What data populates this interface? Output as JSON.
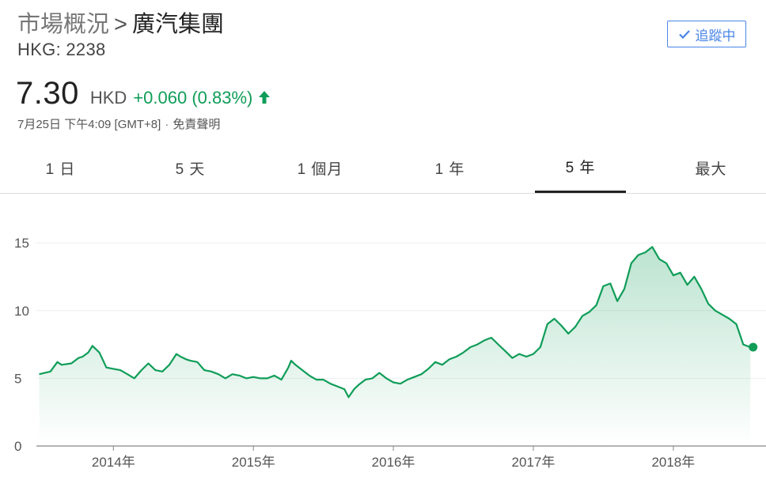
{
  "breadcrumb": {
    "parent": "市場概況",
    "separator": ">",
    "current": "廣汽集團"
  },
  "ticker": "HKG: 2238",
  "follow_button": {
    "label": "追蹤中",
    "icon": "check-icon",
    "color": "#4a86e8"
  },
  "quote": {
    "price": "7.30",
    "currency": "HKD",
    "change": "+0.060 (0.83%)",
    "direction_icon": "arrow-up-icon",
    "change_color": "#0f9d58"
  },
  "meta": {
    "timestamp": "7月25日 下午4:09 [GMT+8]",
    "separator": "·",
    "disclaimer": "免責聲明"
  },
  "tabs": [
    {
      "label": "1 日",
      "active": false
    },
    {
      "label": "5 天",
      "active": false
    },
    {
      "label": "1 個月",
      "active": false
    },
    {
      "label": "1 年",
      "active": false
    },
    {
      "label": "5 年",
      "active": true
    },
    {
      "label": "最大",
      "active": false
    }
  ],
  "chart_data": {
    "type": "area",
    "title": "",
    "xlabel": "",
    "ylabel": "",
    "line_color": "#0f9d58",
    "grid": true,
    "ylim": [
      0,
      16
    ],
    "xlim": [
      2013.45,
      2018.6
    ],
    "yticks": [
      {
        "value": 0,
        "label": "0"
      },
      {
        "value": 5,
        "label": "5"
      },
      {
        "value": 10,
        "label": "10"
      },
      {
        "value": 15,
        "label": "15"
      }
    ],
    "xticks": [
      {
        "value": 2014,
        "label": "2014年"
      },
      {
        "value": 2015,
        "label": "2015年"
      },
      {
        "value": 2016,
        "label": "2016年"
      },
      {
        "value": 2017,
        "label": "2017年"
      },
      {
        "value": 2018,
        "label": "2018年"
      }
    ],
    "series": [
      {
        "x": [
          2013.47,
          2013.55,
          2013.6,
          2013.63,
          2013.7,
          2013.75,
          2013.78,
          2013.82,
          2013.85,
          2013.9,
          2013.95,
          2014.0,
          2014.05,
          2014.1,
          2014.15,
          2014.2,
          2014.25,
          2014.3,
          2014.35,
          2014.4,
          2014.45,
          2014.48,
          2014.52,
          2014.55,
          2014.6,
          2014.65,
          2014.7,
          2014.75,
          2014.8,
          2014.85,
          2014.9,
          2014.95,
          2015.0,
          2015.05,
          2015.1,
          2015.15,
          2015.2,
          2015.25,
          2015.27,
          2015.3,
          2015.35,
          2015.4,
          2015.45,
          2015.5,
          2015.55,
          2015.6,
          2015.65,
          2015.68,
          2015.72,
          2015.75,
          2015.8,
          2015.85,
          2015.9,
          2015.95,
          2016.0,
          2016.05,
          2016.1,
          2016.15,
          2016.2,
          2016.25,
          2016.3,
          2016.35,
          2016.4,
          2016.45,
          2016.5,
          2016.55,
          2016.6,
          2016.65,
          2016.7,
          2016.75,
          2016.8,
          2016.85,
          2016.9,
          2016.95,
          2017.0,
          2017.05,
          2017.1,
          2017.15,
          2017.2,
          2017.25,
          2017.3,
          2017.35,
          2017.4,
          2017.45,
          2017.5,
          2017.55,
          2017.6,
          2017.65,
          2017.7,
          2017.75,
          2017.8,
          2017.85,
          2017.9,
          2017.95,
          2018.0,
          2018.05,
          2018.1,
          2018.15,
          2018.2,
          2018.25,
          2018.3,
          2018.35,
          2018.4,
          2018.45,
          2018.5,
          2018.55
        ],
        "values": [
          5.3,
          5.5,
          6.2,
          6.0,
          6.1,
          6.5,
          6.6,
          6.9,
          7.4,
          6.9,
          5.8,
          5.7,
          5.6,
          5.3,
          5.0,
          5.6,
          6.1,
          5.6,
          5.5,
          6.0,
          6.8,
          6.6,
          6.4,
          6.3,
          6.2,
          5.6,
          5.5,
          5.3,
          5.0,
          5.3,
          5.2,
          5.0,
          5.1,
          5.0,
          5.0,
          5.2,
          4.9,
          5.8,
          6.3,
          6.0,
          5.6,
          5.2,
          4.9,
          4.9,
          4.6,
          4.4,
          4.2,
          3.6,
          4.2,
          4.5,
          4.9,
          5.0,
          5.4,
          5.0,
          4.7,
          4.6,
          4.9,
          5.1,
          5.3,
          5.7,
          6.2,
          6.0,
          6.4,
          6.6,
          6.9,
          7.3,
          7.5,
          7.8,
          8.0,
          7.5,
          7.0,
          6.5,
          6.8,
          6.6,
          6.8,
          7.3,
          9.0,
          9.4,
          8.9,
          8.3,
          8.8,
          9.6,
          9.9,
          10.4,
          11.8,
          12.0,
          10.7,
          11.6,
          13.5,
          14.1,
          14.3,
          14.7,
          13.8,
          13.5,
          12.6,
          12.8,
          11.9,
          12.5,
          11.6,
          10.5,
          10.0,
          9.7,
          9.4,
          9.0,
          7.5,
          7.3
        ]
      }
    ],
    "current_point": {
      "x": 2018.57,
      "value": 7.3
    }
  }
}
